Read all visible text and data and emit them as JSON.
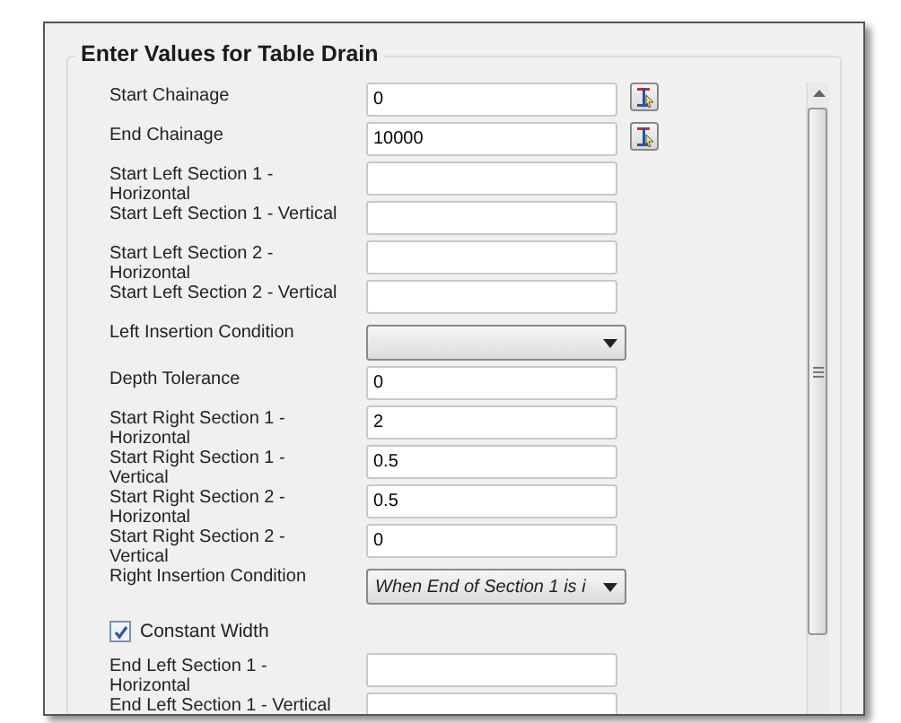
{
  "group": {
    "title": "Enter Values for Table Drain"
  },
  "fields": [
    {
      "kind": "text",
      "label": "Start Chainage",
      "value": "0",
      "picker": true
    },
    {
      "kind": "text",
      "label": "End Chainage",
      "value": "10000",
      "picker": true
    },
    {
      "kind": "text",
      "label": "Start Left Section 1 -\nHorizontal"
    },
    {
      "kind": "text",
      "label": "Start Left Section 1 - Vertical"
    },
    {
      "kind": "text",
      "label": "Start Left Section 2 -\nHorizontal"
    },
    {
      "kind": "text",
      "label": "Start Left Section 2 - Vertical"
    },
    {
      "kind": "combo",
      "label": "Left Insertion Condition"
    },
    {
      "kind": "text",
      "label": "Depth Tolerance",
      "value": "0"
    },
    {
      "kind": "text",
      "label": "Start Right Section 1 -\nHorizontal",
      "value": "2"
    },
    {
      "kind": "text",
      "label": "Start Right Section 1 -\nVertical",
      "value": "0.5"
    },
    {
      "kind": "text",
      "label": "Start Right Section 2 -\nHorizontal",
      "value": "0.5"
    },
    {
      "kind": "text",
      "label": "Start Right Section 2 -\nVertical",
      "value": "0"
    },
    {
      "kind": "combo",
      "label": "Right Insertion Condition",
      "value": "When End of Section 1 is i"
    },
    {
      "kind": "checkbox",
      "label": "Constant Width",
      "checked": true
    },
    {
      "kind": "text",
      "label": "End Left Section 1 -\nHorizontal"
    },
    {
      "kind": "text",
      "label": "End Left Section 1 - Vertical"
    }
  ]
}
